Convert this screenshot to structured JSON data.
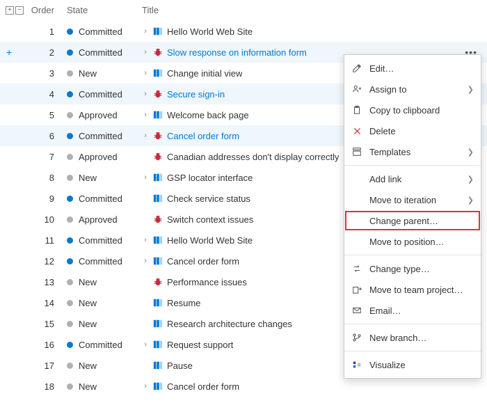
{
  "columns": {
    "order": "Order",
    "state": "State",
    "title": "Title"
  },
  "states": {
    "committed": "Committed",
    "new": "New",
    "approved": "Approved"
  },
  "rows": [
    {
      "order": "1",
      "state": "committed",
      "stateColor": "blue",
      "type": "pbi",
      "title": "Hello World Web Site",
      "chev": true,
      "sel": false
    },
    {
      "order": "2",
      "state": "committed",
      "stateColor": "blue",
      "type": "bug",
      "title": "Slow response on information form",
      "chev": true,
      "sel": true,
      "link": true,
      "plus": true
    },
    {
      "order": "3",
      "state": "new",
      "stateColor": "gray",
      "type": "pbi",
      "title": "Change initial view",
      "chev": true
    },
    {
      "order": "4",
      "state": "committed",
      "stateColor": "blue",
      "type": "bug",
      "title": "Secure sign-in",
      "chev": true,
      "sel": true,
      "link": true
    },
    {
      "order": "5",
      "state": "approved",
      "stateColor": "gray",
      "type": "pbi",
      "title": "Welcome back page",
      "chev": true
    },
    {
      "order": "6",
      "state": "committed",
      "stateColor": "blue",
      "type": "bug",
      "title": "Cancel order form",
      "chev": true,
      "sel": true,
      "link": true
    },
    {
      "order": "7",
      "state": "approved",
      "stateColor": "gray",
      "type": "bug",
      "title": "Canadian addresses don't display correctly",
      "chev": false
    },
    {
      "order": "8",
      "state": "new",
      "stateColor": "gray",
      "type": "pbi",
      "title": "GSP locator interface",
      "chev": true
    },
    {
      "order": "9",
      "state": "committed",
      "stateColor": "blue",
      "type": "pbi",
      "title": "Check service status",
      "chev": false
    },
    {
      "order": "10",
      "state": "approved",
      "stateColor": "gray",
      "type": "bug",
      "title": "Switch context issues",
      "chev": false
    },
    {
      "order": "11",
      "state": "committed",
      "stateColor": "blue",
      "type": "pbi",
      "title": "Hello World Web Site",
      "chev": true
    },
    {
      "order": "12",
      "state": "committed",
      "stateColor": "blue",
      "type": "pbi",
      "title": "Cancel order form",
      "chev": true
    },
    {
      "order": "13",
      "state": "new",
      "stateColor": "gray",
      "type": "bug",
      "title": "Performance issues",
      "chev": false
    },
    {
      "order": "14",
      "state": "new",
      "stateColor": "gray",
      "type": "pbi",
      "title": "Resume",
      "chev": false
    },
    {
      "order": "15",
      "state": "new",
      "stateColor": "gray",
      "type": "pbi",
      "title": "Research architecture changes",
      "chev": false
    },
    {
      "order": "16",
      "state": "committed",
      "stateColor": "blue",
      "type": "pbi",
      "title": "Request support",
      "chev": true
    },
    {
      "order": "17",
      "state": "new",
      "stateColor": "gray",
      "type": "pbi",
      "title": "Pause",
      "chev": false
    },
    {
      "order": "18",
      "state": "new",
      "stateColor": "gray",
      "type": "pbi",
      "title": "Cancel order form",
      "chev": true
    }
  ],
  "menu": {
    "edit": "Edit…",
    "assign": "Assign to",
    "copy": "Copy to clipboard",
    "delete": "Delete",
    "templates": "Templates",
    "addlink": "Add link",
    "moveiter": "Move to iteration",
    "changeparent": "Change parent…",
    "movepos": "Move to position…",
    "changetype": "Change type…",
    "moveproj": "Move to team project…",
    "email": "Email…",
    "branch": "New branch…",
    "visualize": "Visualize"
  }
}
